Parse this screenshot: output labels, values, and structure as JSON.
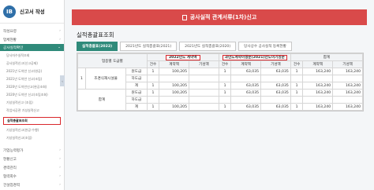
{
  "sidebar": {
    "logo_text": "IB",
    "title": "신고서 작성",
    "items": [
      {
        "label": "작성요령",
        "chev": "›"
      },
      {
        "label": "업체현황",
        "chev": "›"
      },
      {
        "label": "공사실적확인",
        "chev": "⌄"
      }
    ],
    "sub_items": [
      "당사자수실적조회",
      "공사실적신고(신고공제)",
      "2021년 도약안 신고(완공)",
      "2021년 도약안 신고(조립)",
      "2020년 도약안신고(완공조회)",
      "2020년 도약안 신고(조립조회)",
      "기성실적신고 (조립)",
      "작업서공관 기성실적신고",
      "실적총괄표조회",
      "기성실적신고(완공·수행)",
      "기성실적신고(조립)"
    ],
    "bottom_items": [
      {
        "label": "기업능력평가",
        "chev": "›"
      },
      {
        "label": "현황신고",
        "chev": "›"
      },
      {
        "label": "경력관리",
        "chev": "›"
      },
      {
        "label": "협력회수",
        "chev": "›"
      },
      {
        "label": "건설업경력",
        "chev": "›"
      }
    ],
    "collapse": "‹"
  },
  "header": {
    "title": "공사실적 관계서류(1차)신고"
  },
  "page_title": "실적총괄표조회",
  "tabs": [
    "실적총괄표(2022)",
    "2021년도 실적총괄표(2021)",
    "2021년도 실적총괄표(2020)",
    "당사상수 공사실적 등록현황"
  ],
  "table": {
    "head_row1": [
      "업종별 도급별",
      "2022년도 계약액",
      "과년도계약이행분(2021)년도이기성분",
      "합계"
    ],
    "head_row2": [
      "건수",
      "계약액",
      "기성액",
      "건수",
      "계약액",
      "기성액",
      "건수",
      "계약액",
      "기성액"
    ],
    "rows": [
      {
        "no": "1",
        "industry": "조경식재시설물",
        "type": "원도급",
        "values": [
          "1",
          "100,205",
          "",
          "1",
          "63,035",
          "63,035",
          "1",
          "163,240",
          "163,240"
        ]
      },
      {
        "no": "",
        "industry": "",
        "type": "하도급",
        "values": [
          "",
          "",
          "",
          "",
          "",
          "",
          "",
          "",
          ""
        ]
      },
      {
        "no": "",
        "industry": "",
        "type": "계",
        "values": [
          "1",
          "100,205",
          "",
          "1",
          "63,035",
          "63,035",
          "1",
          "163,240",
          "163,240"
        ]
      },
      {
        "no": "",
        "industry": "합계",
        "type": "원도급",
        "values": [
          "1",
          "100,205",
          "",
          "1",
          "63,035",
          "63,035",
          "1",
          "163,240",
          "163,240"
        ]
      },
      {
        "no": "",
        "industry": "",
        "type": "하도급",
        "values": [
          "",
          "",
          "",
          "",
          "",
          "",
          "",
          "",
          ""
        ]
      },
      {
        "no": "",
        "industry": "",
        "type": "계",
        "values": [
          "1",
          "100,205",
          "",
          "1",
          "63,035",
          "63,035",
          "1",
          "163,240",
          "163,240"
        ]
      }
    ]
  },
  "colors": {
    "accent": "#2f8a7a",
    "header_red": "#d94a4a",
    "highlight": "#d9262b"
  }
}
